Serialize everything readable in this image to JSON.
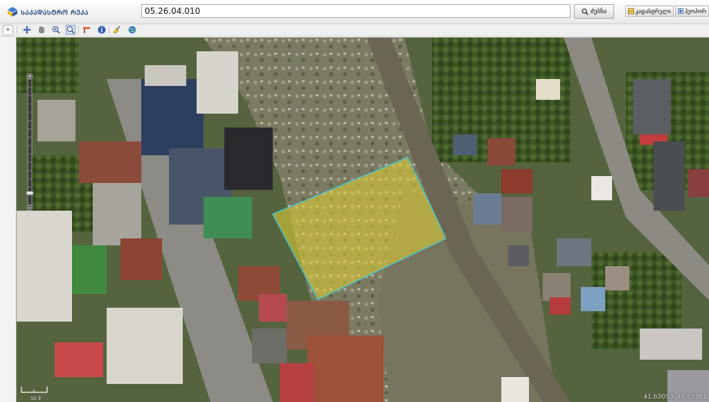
{
  "header": {
    "logo_text": "ᲡᲐᲙᲐᲓᲐᲡᲢᲠᲝ ᲠᲣᲙᲐ",
    "search_value": "05.26.04.010",
    "search_button": "ძებნა",
    "btn_cadastral": "კადასტრული",
    "btn_geoportal": "ჰეოპორ"
  },
  "toolbar": {
    "expander": "»",
    "tools": [
      "pan-icon",
      "hand-icon",
      "zoom-in-icon",
      "zoom-box-icon",
      "measure-icon",
      "info-icon",
      "highlight-icon",
      "globe-icon"
    ]
  },
  "map": {
    "scale_label": "50 მ",
    "coords": "41.63059, 41.63561"
  },
  "colors": {
    "parcel_fill": "#e3d433",
    "parcel_stroke": "#48c8cf",
    "accent": "#1a3e7a"
  }
}
